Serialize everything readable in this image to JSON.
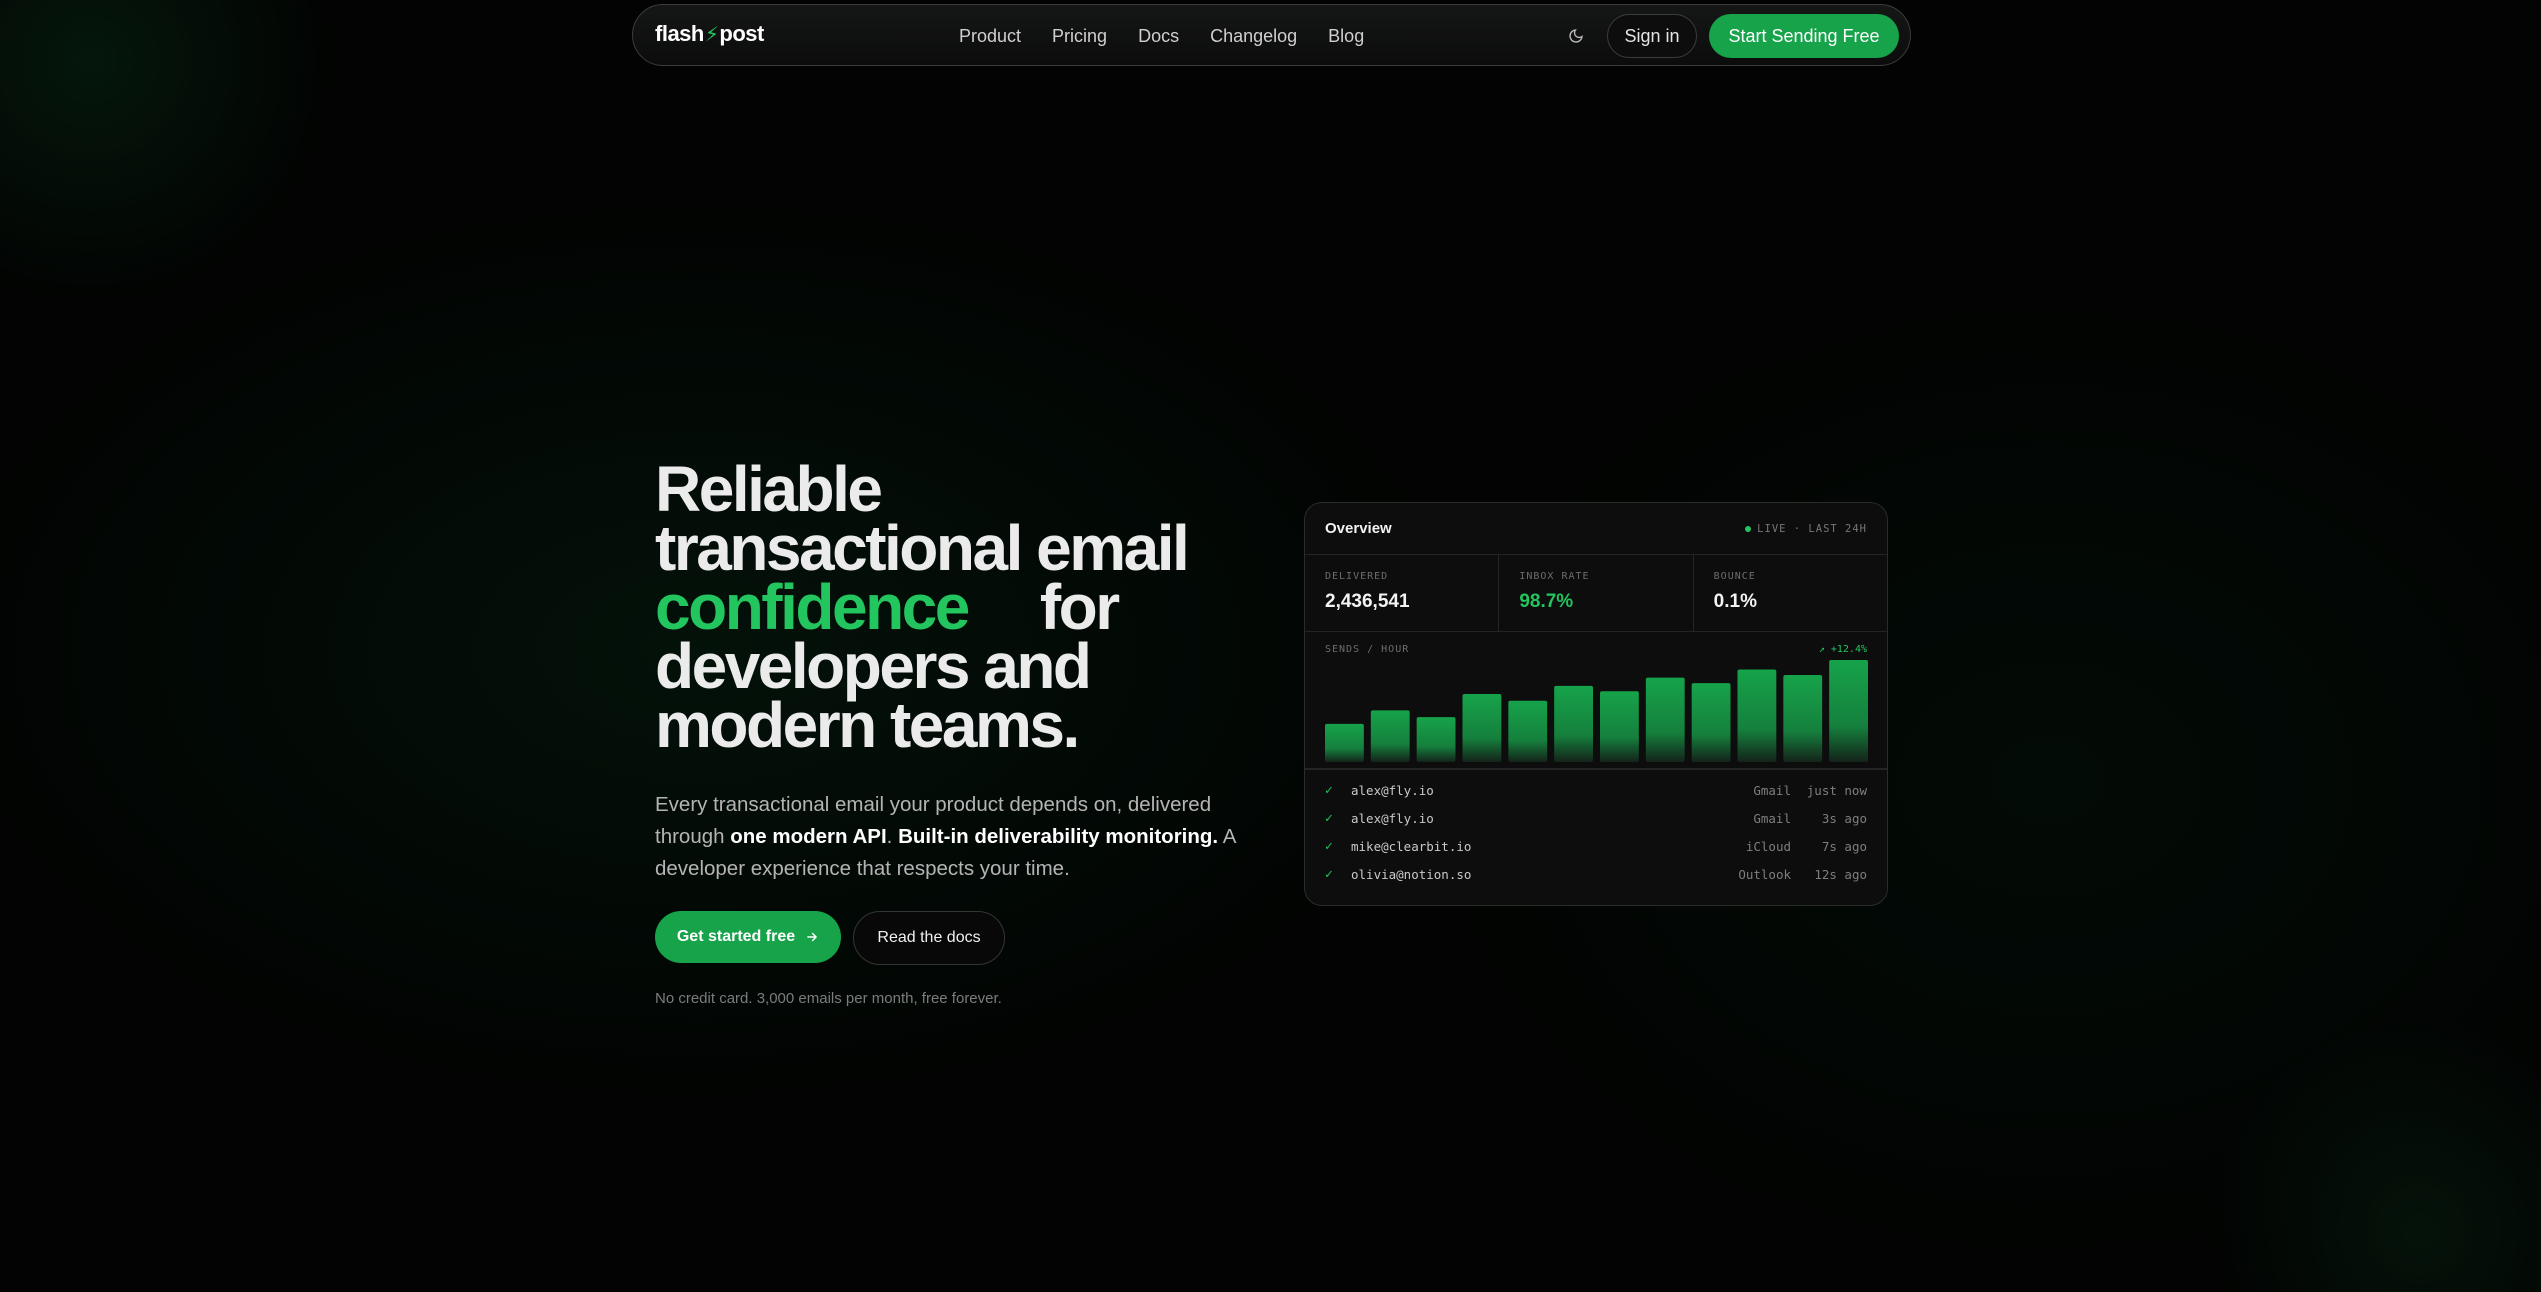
{
  "brand": {
    "name_left": "flash",
    "name_right": "post"
  },
  "nav": {
    "links": [
      "Product",
      "Pricing",
      "Docs",
      "Changelog",
      "Blog"
    ],
    "theme_icon": "moon-icon",
    "signin": "Sign in",
    "cta": "Start Sending Free"
  },
  "hero": {
    "line1": "Reliable",
    "line2": "transactional email",
    "accent": "confidence",
    "line3_rest": "for",
    "line4": "developers and",
    "line5": "modern teams.",
    "sub_1": "Every transactional email your product depends on, delivered through ",
    "sub_b1": "one modern API",
    "sub_2": ". ",
    "sub_b2": "Built-in deliverability monitoring.",
    "sub_3": " A developer experience that respects your time.",
    "btn_primary": "Get started free",
    "btn_secondary": "Read the docs",
    "fineprint": "No credit card. 3,000 emails per month, free forever."
  },
  "card": {
    "title": "Overview",
    "live": "LIVE · LAST 24H",
    "stats": [
      {
        "label": "DELIVERED",
        "value": "2,436,541"
      },
      {
        "label": "INBOX RATE",
        "value": "98.7%"
      },
      {
        "label": "BOUNCE",
        "value": "0.1%"
      }
    ],
    "chart_label": "SENDS / HOUR",
    "trend": "↗ +12.4%",
    "events": [
      {
        "address": "alex@fly.io",
        "client": "Gmail",
        "time": "just now"
      },
      {
        "address": "alex@fly.io",
        "client": "Gmail",
        "time": "3s ago"
      },
      {
        "address": "mike@clearbit.io",
        "client": "iCloud",
        "time": "7s ago"
      },
      {
        "address": "olivia@notion.so",
        "client": "Outlook",
        "time": "12s ago"
      }
    ]
  },
  "colors": {
    "accent": "#22c55e",
    "button": "#16a34a",
    "background": "#020302"
  },
  "chart_data": {
    "type": "bar",
    "values": [
      28,
      38,
      33,
      50,
      45,
      56,
      52,
      62,
      58,
      68,
      64,
      75
    ],
    "ylim": [
      0,
      75
    ]
  }
}
